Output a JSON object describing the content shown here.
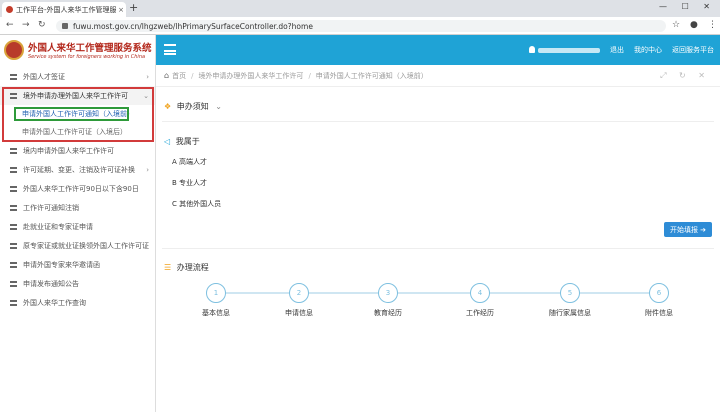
{
  "browser": {
    "tab_title": "工作平台-外国人来华工作管理服",
    "tab_close": "×",
    "new_tab": "+",
    "window_controls": "— ☐ ✕",
    "url": "fuwu.most.gov.cn/lhgzweb/lhPrimarySurfaceController.do?home",
    "back": "←",
    "forward": "→",
    "reload": "↻",
    "star": "☆",
    "account": "●",
    "menu": "⋮"
  },
  "logo": {
    "title_cn": "外国人来华工作管理服务系统",
    "title_en": "Service system for foreigners working in China"
  },
  "sidebar": {
    "items": [
      {
        "label": "外国人才签证",
        "arrow": "›"
      },
      {
        "label": "境外申请办理外国人来华工作许可",
        "arrow": "⌄"
      },
      {
        "label": "境内申请外国人来华工作许可"
      },
      {
        "label": "许可延期、变更、注销及许可证补换",
        "arrow": "›"
      },
      {
        "label": "外国人来华工作许可90日以下含90日"
      },
      {
        "label": "工作许可通知注销"
      },
      {
        "label": "赴就业证和专家证申请"
      },
      {
        "label": "原专家证或就业证换领外国人工作许可证"
      },
      {
        "label": "申请外国专家来华邀请函"
      },
      {
        "label": "申请发布通知公告"
      },
      {
        "label": "外国人来华工作查询"
      }
    ],
    "subitems": [
      {
        "label": "申请外国人工作许可通知（入境前）"
      },
      {
        "label": "申请外国人工作许可证（入境后）"
      }
    ]
  },
  "topbar": {
    "exit": "退出",
    "personal_center": "我的中心",
    "service_platform": "返回服务平台"
  },
  "breadcrumb": {
    "home": "首页",
    "level1": "境外申请办理外国人来华工作许可",
    "level2": "申请外国人工作许可通知（入境前）",
    "tools": "⤢ ↻ ✕"
  },
  "apply_notice": {
    "title": "申办须知",
    "arrow": "⌄"
  },
  "belongs": {
    "title": "我属于",
    "options": [
      "A 高端人才",
      "B 专业人才",
      "C 其他外国人员"
    ]
  },
  "start_button": "开始填报 ➔",
  "process": {
    "title": "办理流程",
    "steps": [
      {
        "num": "1",
        "label": "基本信息"
      },
      {
        "num": "2",
        "label": "申请信息"
      },
      {
        "num": "3",
        "label": "教育经历"
      },
      {
        "num": "4",
        "label": "工作经历"
      },
      {
        "num": "5",
        "label": "随行家属信息"
      },
      {
        "num": "6",
        "label": "附件信息"
      }
    ]
  }
}
